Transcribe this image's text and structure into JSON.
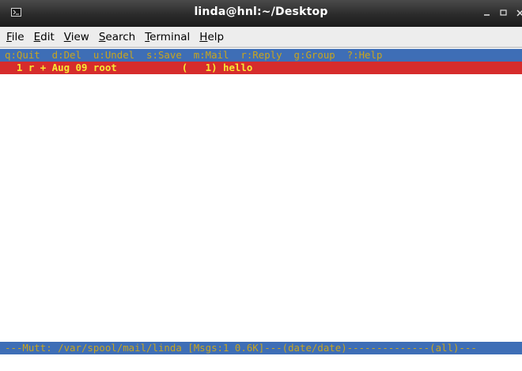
{
  "window": {
    "title": "linda@hnl:~/Desktop",
    "icon": "terminal-icon",
    "controls": [
      "minimize-icon",
      "maximize-icon",
      "close-icon"
    ]
  },
  "menubar": {
    "items": [
      {
        "mnemonic": "F",
        "rest": "ile"
      },
      {
        "mnemonic": "E",
        "rest": "dit"
      },
      {
        "mnemonic": "V",
        "rest": "iew"
      },
      {
        "mnemonic": "S",
        "rest": "earch"
      },
      {
        "mnemonic": "T",
        "rest": "erminal"
      },
      {
        "mnemonic": "H",
        "rest": "elp"
      }
    ]
  },
  "mutt": {
    "help_line": "q:Quit  d:Del  u:Undel  s:Save  m:Mail  r:Reply  g:Group  ?:Help",
    "messages": [
      {
        "line": "  1 r + Aug 09 root           (   1) hello"
      }
    ],
    "status_line": "---Mutt: /var/spool/mail/linda [Msgs:1 0.6K]---(date/date)--------------(all)---"
  },
  "colors": {
    "titlebar": "#2b2b2b",
    "help_bar_bg": "#3e6eb6",
    "help_bar_fg": "#c9a51e",
    "selected_row_bg": "#d62c2c",
    "selected_row_fg": "#f7e634",
    "terminal_bg": "#ffffff"
  }
}
